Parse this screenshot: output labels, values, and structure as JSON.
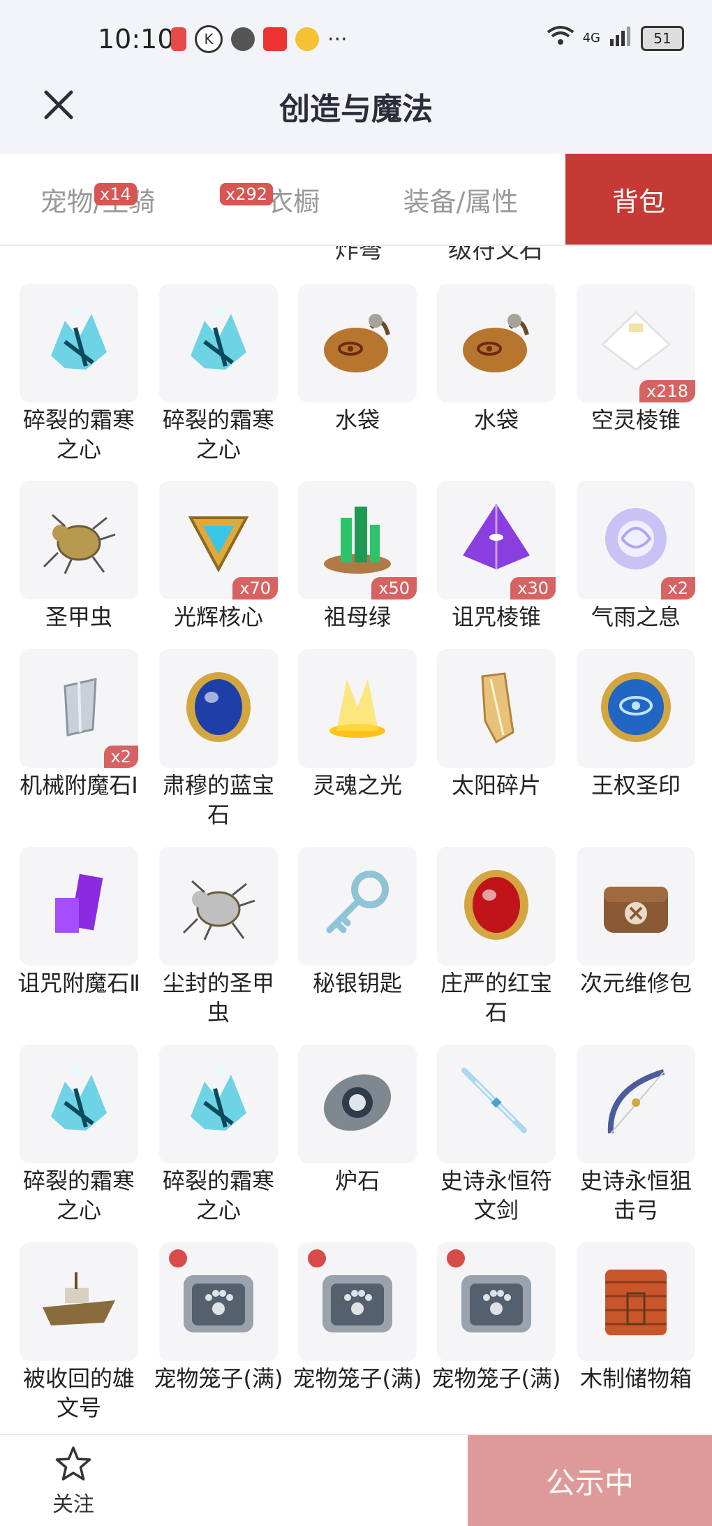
{
  "status_bar": {
    "time": "10:10",
    "battery": "51",
    "network": "4G",
    "more": "···"
  },
  "header": {
    "title": "创造与魔法"
  },
  "tabs": [
    {
      "label": "宠物/坐骑",
      "badge": "x14",
      "active": false
    },
    {
      "label": "衣橱",
      "badge": "x292",
      "active": false
    },
    {
      "label": "装备/属性",
      "badge": "",
      "active": false
    },
    {
      "label": "背包",
      "badge": "",
      "active": true
    }
  ],
  "partial_row": [
    "炸弩",
    "级符文石"
  ],
  "items": [
    {
      "name": "碎裂的霜寒之心",
      "qty": "",
      "icon": "frost-heart-icon",
      "color": "#6fd3e6"
    },
    {
      "name": "碎裂的霜寒之心",
      "qty": "",
      "icon": "frost-heart-icon",
      "color": "#6fd3e6"
    },
    {
      "name": "水袋",
      "qty": "",
      "icon": "water-bag-icon",
      "color": "#b8752e"
    },
    {
      "name": "水袋",
      "qty": "",
      "icon": "water-bag-icon",
      "color": "#b8752e"
    },
    {
      "name": "空灵棱锥",
      "qty": "x218",
      "icon": "ethereal-pyramid-icon",
      "color": "#f0f0f0"
    },
    {
      "name": "圣甲虫",
      "qty": "",
      "icon": "scarab-icon",
      "color": "#b89a4e"
    },
    {
      "name": "光辉核心",
      "qty": "x70",
      "icon": "radiant-core-icon",
      "color": "#e0a93a"
    },
    {
      "name": "祖母绿",
      "qty": "x50",
      "icon": "emerald-icon",
      "color": "#2ec26a"
    },
    {
      "name": "诅咒棱锥",
      "qty": "x30",
      "icon": "cursed-pyramid-icon",
      "color": "#8a3ee0"
    },
    {
      "name": "气雨之息",
      "qty": "x2",
      "icon": "breath-orb-icon",
      "color": "#c9c3f5"
    },
    {
      "name": "机械附魔石Ⅰ",
      "qty": "x2",
      "icon": "mech-enchant-stone-icon",
      "color": "#c9d0d8"
    },
    {
      "name": "肃穆的蓝宝石",
      "qty": "",
      "icon": "sapphire-icon",
      "color": "#1f3fa8"
    },
    {
      "name": "灵魂之光",
      "qty": "",
      "icon": "soul-light-icon",
      "color": "#ffe04a"
    },
    {
      "name": "太阳碎片",
      "qty": "",
      "icon": "sun-shard-icon",
      "color": "#e8c27a"
    },
    {
      "name": "王权圣印",
      "qty": "",
      "icon": "royal-seal-icon",
      "color": "#2166c2"
    },
    {
      "name": "诅咒附魔石Ⅱ",
      "qty": "",
      "icon": "cursed-enchant-stone-icon",
      "color": "#8a2be2"
    },
    {
      "name": "尘封的圣甲虫",
      "qty": "",
      "icon": "dusty-scarab-icon",
      "color": "#bfbfbf"
    },
    {
      "name": "秘银钥匙",
      "qty": "",
      "icon": "mithril-key-icon",
      "color": "#8fc3d6"
    },
    {
      "name": "庄严的红宝石",
      "qty": "",
      "icon": "ruby-icon",
      "color": "#c0141a"
    },
    {
      "name": "次元维修包",
      "qty": "",
      "icon": "repair-kit-icon",
      "color": "#8a5a34"
    },
    {
      "name": "碎裂的霜寒之心",
      "qty": "",
      "icon": "frost-heart-icon",
      "color": "#6fd3e6"
    },
    {
      "name": "碎裂的霜寒之心",
      "qty": "",
      "icon": "frost-heart-icon",
      "color": "#6fd3e6"
    },
    {
      "name": "炉石",
      "qty": "",
      "icon": "hearthstone-icon",
      "color": "#7f8790"
    },
    {
      "name": "史诗永恒符文剑",
      "qty": "",
      "icon": "rune-sword-icon",
      "color": "#a9d8ef"
    },
    {
      "name": "史诗永恒狙击弓",
      "qty": "",
      "icon": "sniper-bow-icon",
      "color": "#4a5d9a"
    },
    {
      "name": "被收回的雄文号",
      "qty": "",
      "icon": "ship-icon",
      "color": "#8a6b3c"
    },
    {
      "name": "宠物笼子(满)",
      "qty": "",
      "icon": "pet-cage-icon",
      "color": "#55606e",
      "tagged": true
    },
    {
      "name": "宠物笼子(满)",
      "qty": "",
      "icon": "pet-cage-icon",
      "color": "#55606e",
      "tagged": true
    },
    {
      "name": "宠物笼子(满)",
      "qty": "",
      "icon": "pet-cage-icon",
      "color": "#55606e",
      "tagged": true
    },
    {
      "name": "木制储物箱",
      "qty": "",
      "icon": "wooden-box-icon",
      "color": "#c9552a"
    }
  ],
  "footer": {
    "follow_label": "关注",
    "publish_label": "公示中"
  },
  "colors": {
    "accent": "#c53a34",
    "badge": "#d76262",
    "publish": "#de9a98"
  }
}
